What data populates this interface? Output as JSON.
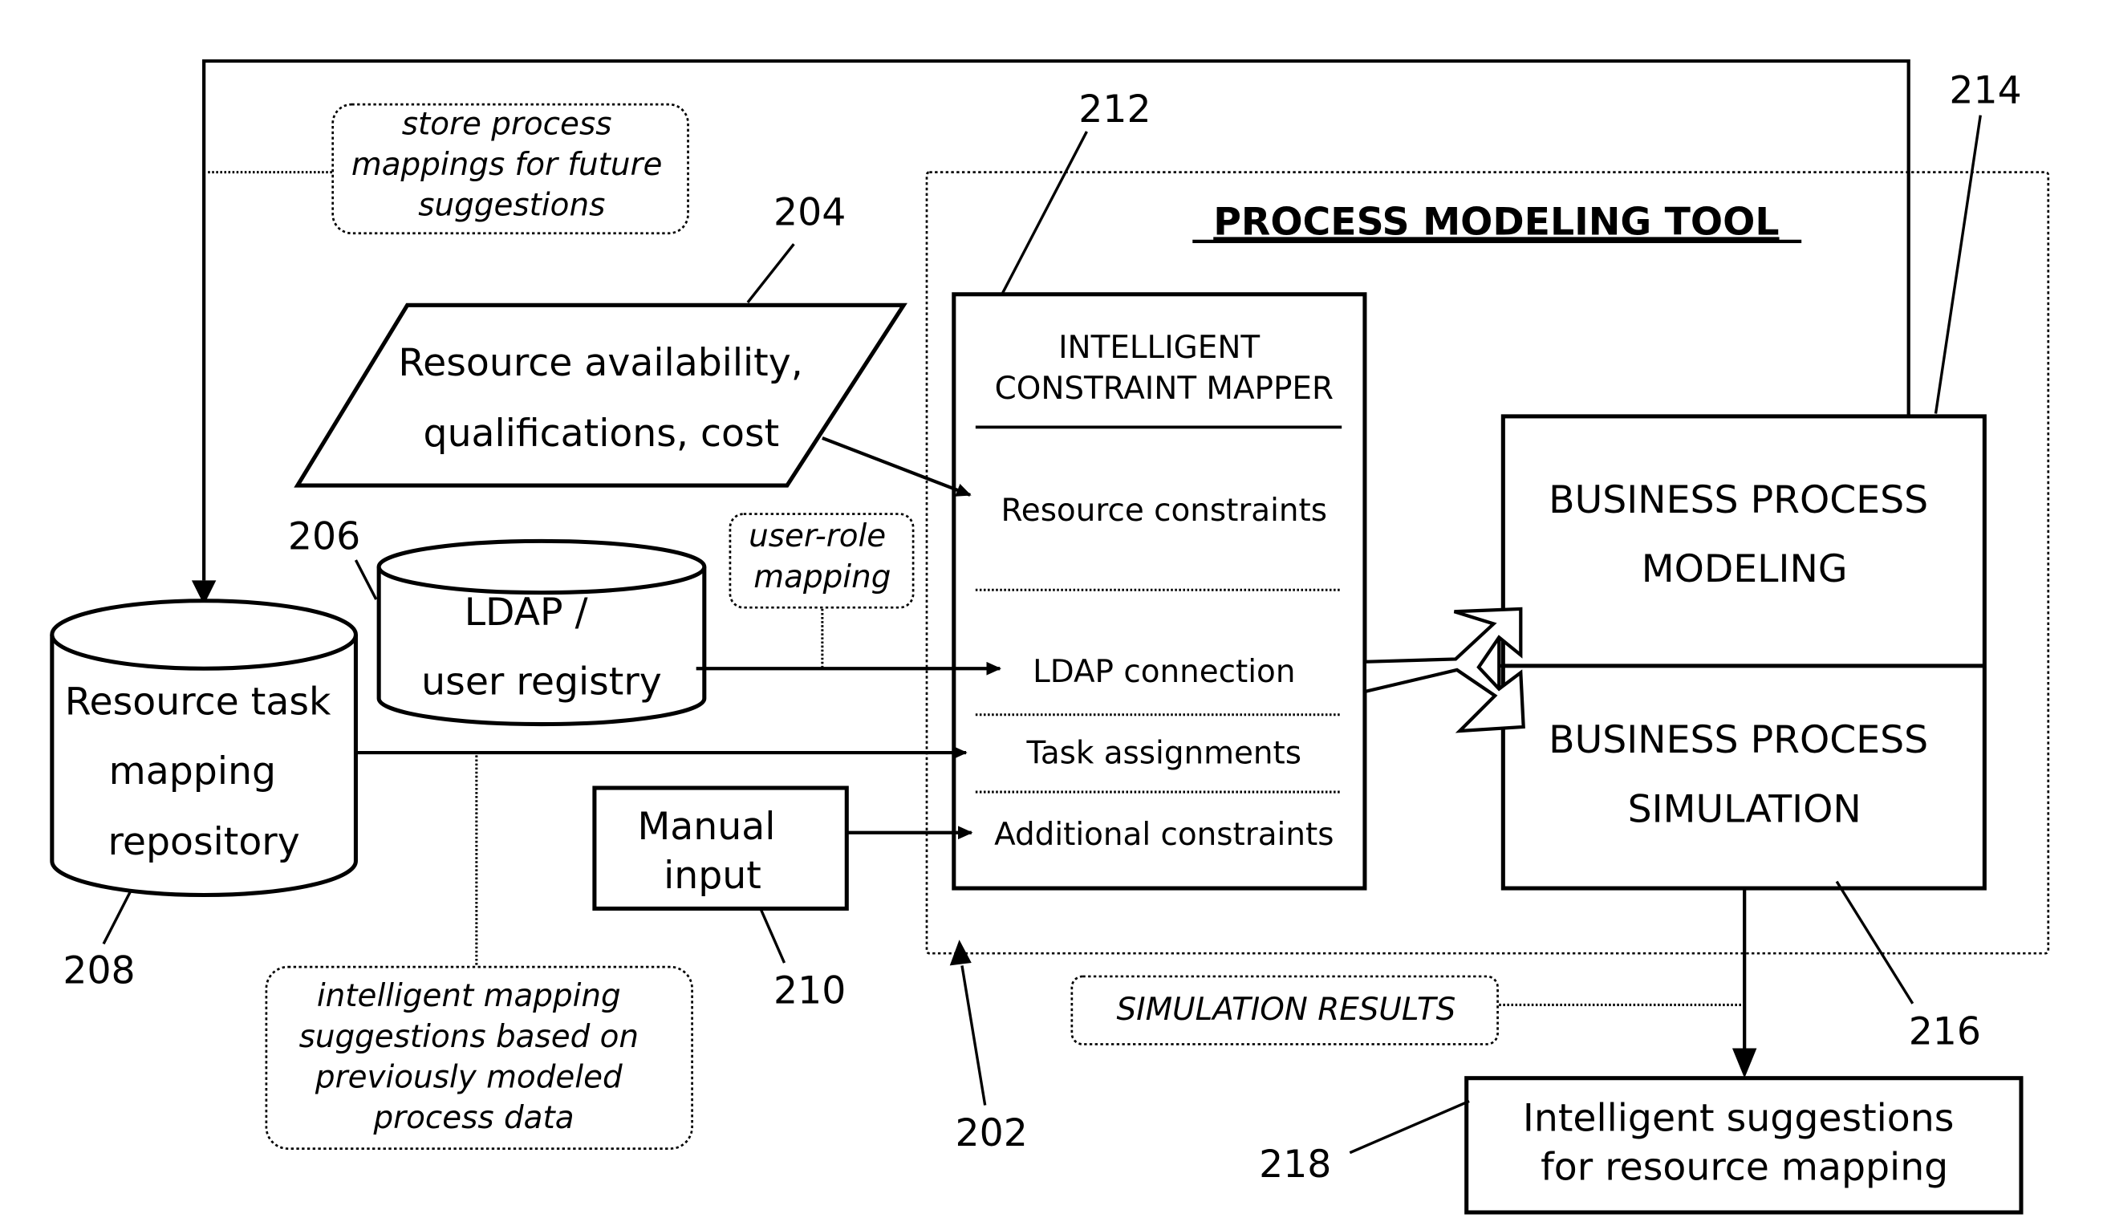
{
  "title": "Process modeling tool with intelligent constraint mapper",
  "process_modeling_tool": {
    "title": "PROCESS MODELING TOOL",
    "ref": "202"
  },
  "resource_input": {
    "lines": [
      "Resource availability,",
      "qualifications, cost"
    ],
    "ref": "204"
  },
  "ldap": {
    "lines": [
      "LDAP /",
      "user registry"
    ],
    "ref": "206"
  },
  "repository": {
    "lines": [
      "Resource task",
      "mapping",
      "repository"
    ],
    "ref": "208"
  },
  "manual_input": {
    "lines": [
      "Manual",
      "input"
    ],
    "ref": "210"
  },
  "mapper": {
    "title_lines": [
      "INTELLIGENT",
      "CONSTRAINT MAPPER"
    ],
    "items": [
      "Resource constraints",
      "LDAP connection",
      "Task assignments",
      "Additional constraints"
    ],
    "ref": "212"
  },
  "bp_modeling": {
    "lines": [
      "BUSINESS PROCESS",
      "MODELING"
    ],
    "ref": "214"
  },
  "bp_simulation": {
    "lines": [
      "BUSINESS PROCESS",
      "SIMULATION"
    ],
    "ref": "216"
  },
  "suggestions": {
    "lines": [
      "Intelligent suggestions",
      "for resource mapping"
    ],
    "ref": "218"
  },
  "notes": {
    "store": [
      "store process",
      "mappings for future",
      "suggestions"
    ],
    "user_role": [
      "user-role",
      "mapping"
    ],
    "intelligent": [
      "intelligent mapping",
      "suggestions based on",
      "previously modeled",
      "process data"
    ],
    "simulation_results": "SIMULATION RESULTS"
  }
}
